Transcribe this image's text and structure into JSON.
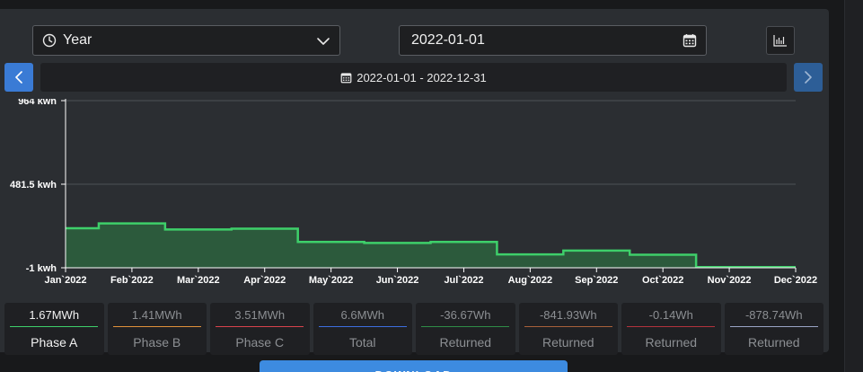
{
  "toolbar": {
    "period_select": {
      "value": "Year"
    },
    "date_input": {
      "value": "2022-01-01"
    }
  },
  "range_label": "2022-01-01 - 2022-12-31",
  "chart_data": {
    "type": "area",
    "step": true,
    "x": [
      "Jan`2022",
      "Feb`2022",
      "Mar`2022",
      "Apr`2022",
      "May`2022",
      "Jun`2022",
      "Jul`2022",
      "Aug`2022",
      "Sep`2022",
      "Oct`2022",
      "Nov`2022",
      "Dec`2022"
    ],
    "series": [
      {
        "values": [
          227,
          255,
          220,
          225,
          148,
          142,
          148,
          76,
          98,
          74,
          3,
          3
        ]
      }
    ],
    "yticks": [
      "964 kwh",
      "481.5 kwh",
      "-1 kwh"
    ],
    "ylim": [
      -1,
      964
    ],
    "grid": true,
    "colors": {
      "line": "#3ecf6a",
      "fill": "#2c5a3c"
    }
  },
  "stats": [
    {
      "value": "1.67MWh",
      "label": "Phase A",
      "color": "#3ecf6a",
      "active": true
    },
    {
      "value": "1.41MWh",
      "label": "Phase B",
      "color": "#e0913a",
      "active": false
    },
    {
      "value": "3.51MWh",
      "label": "Phase C",
      "color": "#d9434c",
      "active": false
    },
    {
      "value": "6.6MWh",
      "label": "Total",
      "color": "#3d6ee0",
      "active": false
    },
    {
      "value": "-36.67Wh",
      "label": "Returned",
      "color": "#2f8c47",
      "active": false
    },
    {
      "value": "-841.93Wh",
      "label": "Returned",
      "color": "#a8603a",
      "active": false
    },
    {
      "value": "-0.14Wh",
      "label": "Returned",
      "color": "#b2333c",
      "active": false
    },
    {
      "value": "-878.74Wh",
      "label": "Returned",
      "color": "#9aa4c6",
      "active": false
    }
  ],
  "download_label": "DOWNLOAD"
}
